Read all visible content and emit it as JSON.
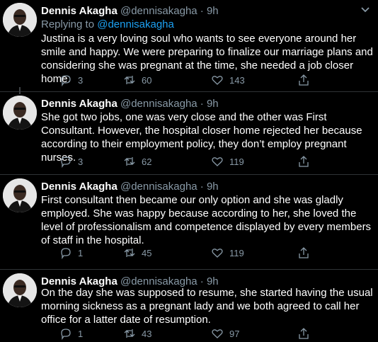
{
  "author": {
    "name": "Dennis Akagha",
    "handle": "@dennisakagha",
    "dot": "·",
    "time": "9h"
  },
  "replying": {
    "prefix": "Replying to ",
    "mention": "@dennisakagha"
  },
  "colors": {
    "background": "#000000",
    "accent": "#1da1f2",
    "muted": "#8899a6",
    "text": "#ffffff",
    "divider": "#2f3336"
  },
  "icons": {
    "reply": "reply-icon",
    "retweet": "retweet-icon",
    "like": "heart-icon",
    "share": "share-icon",
    "more": "more-icon"
  },
  "tweets": [
    {
      "text": "Justina is a very loving soul who wants to see everyone around her smile and happy. We were preparing to finalize our marriage plans and considering she was pregnant at the time, she needed a job closer home.",
      "replies": "3",
      "retweets": "60",
      "likes": "143"
    },
    {
      "text": "She got two jobs, one was very close and the other was First Consultant. However, the hospital closer home rejected her because according to their employment policy, they don’t employ pregnant nurses.",
      "replies": "3",
      "retweets": "62",
      "likes": "119"
    },
    {
      "text": "First consultant then became our only option and she was gladly employed. She was happy because according to her, she loved the level of professionalism and competence displayed by every members of staff in the hospital.",
      "replies": "1",
      "retweets": "45",
      "likes": "119"
    },
    {
      "text": "On the day she was supposed to resume, she started having the usual morning sickness as a pregnant lady and we both agreed to call her office for a latter date of resumption.",
      "replies": "1",
      "retweets": "43",
      "likes": "97"
    }
  ]
}
